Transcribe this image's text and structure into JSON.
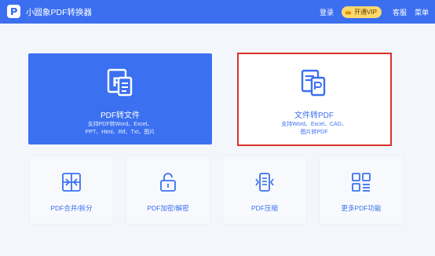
{
  "app": {
    "title": "小圆象PDF转换器"
  },
  "titlebar": {
    "login": "登录",
    "vip_label": "开通VIP",
    "support": "客服",
    "menu": "菜单"
  },
  "features": {
    "pdf_to_file": {
      "title": "PDF转文件",
      "desc_line1": "支持PDF转Word、Excel、",
      "desc_line2": "PPT、Html、Rtf、Txt、图片"
    },
    "file_to_pdf": {
      "title": "文件转PDF",
      "desc_line1": "支持Word、Excel、CAD、",
      "desc_line2": "图片转PDF"
    }
  },
  "tools": [
    {
      "label": "PDF合并/拆分",
      "icon": "merge-split-icon"
    },
    {
      "label": "PDF加密/解密",
      "icon": "lock-icon"
    },
    {
      "label": "PDF压缩",
      "icon": "compress-icon"
    },
    {
      "label": "更多PDF功能",
      "icon": "more-grid-icon"
    }
  ],
  "colors": {
    "titlebar": "#3b6ff0",
    "accent": "#3b70f0",
    "highlight_border": "#d9322b",
    "vip_bg": "#ffd86b"
  }
}
